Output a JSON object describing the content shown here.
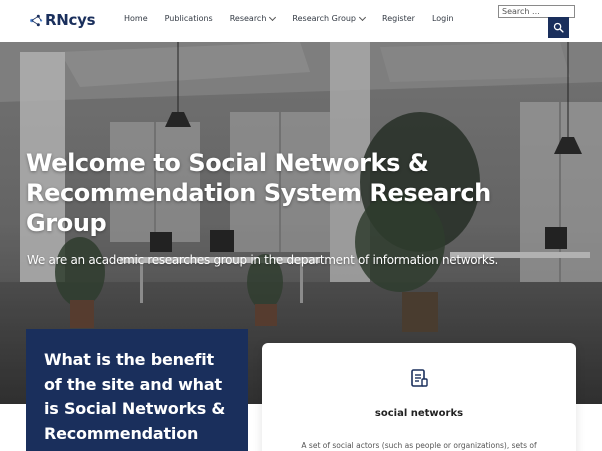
{
  "header": {
    "logo_text": "RNcys",
    "nav": [
      {
        "label": "Home",
        "has_dropdown": false
      },
      {
        "label": "Publications",
        "has_dropdown": false
      },
      {
        "label": "Research",
        "has_dropdown": true
      },
      {
        "label": "Research Group",
        "has_dropdown": true
      },
      {
        "label": "Register",
        "has_dropdown": false
      },
      {
        "label": "Login",
        "has_dropdown": false
      }
    ],
    "search": {
      "placeholder": "Search ...",
      "button_icon": "search-icon"
    }
  },
  "hero": {
    "title": "Welcome to Social Networks & Recommendation System Research Group",
    "subtitle": "We are an academic researches group in the department of information networks."
  },
  "benefit_card": {
    "text": "What is the benefit of the site and what is Social Networks & Recommendation"
  },
  "feature_card": {
    "icon": "document-icon",
    "title": "social networks",
    "description": "A set of social actors (such as people or organizations), sets of"
  },
  "colors": {
    "brand_navy": "#1a2f5c",
    "white": "#ffffff"
  }
}
